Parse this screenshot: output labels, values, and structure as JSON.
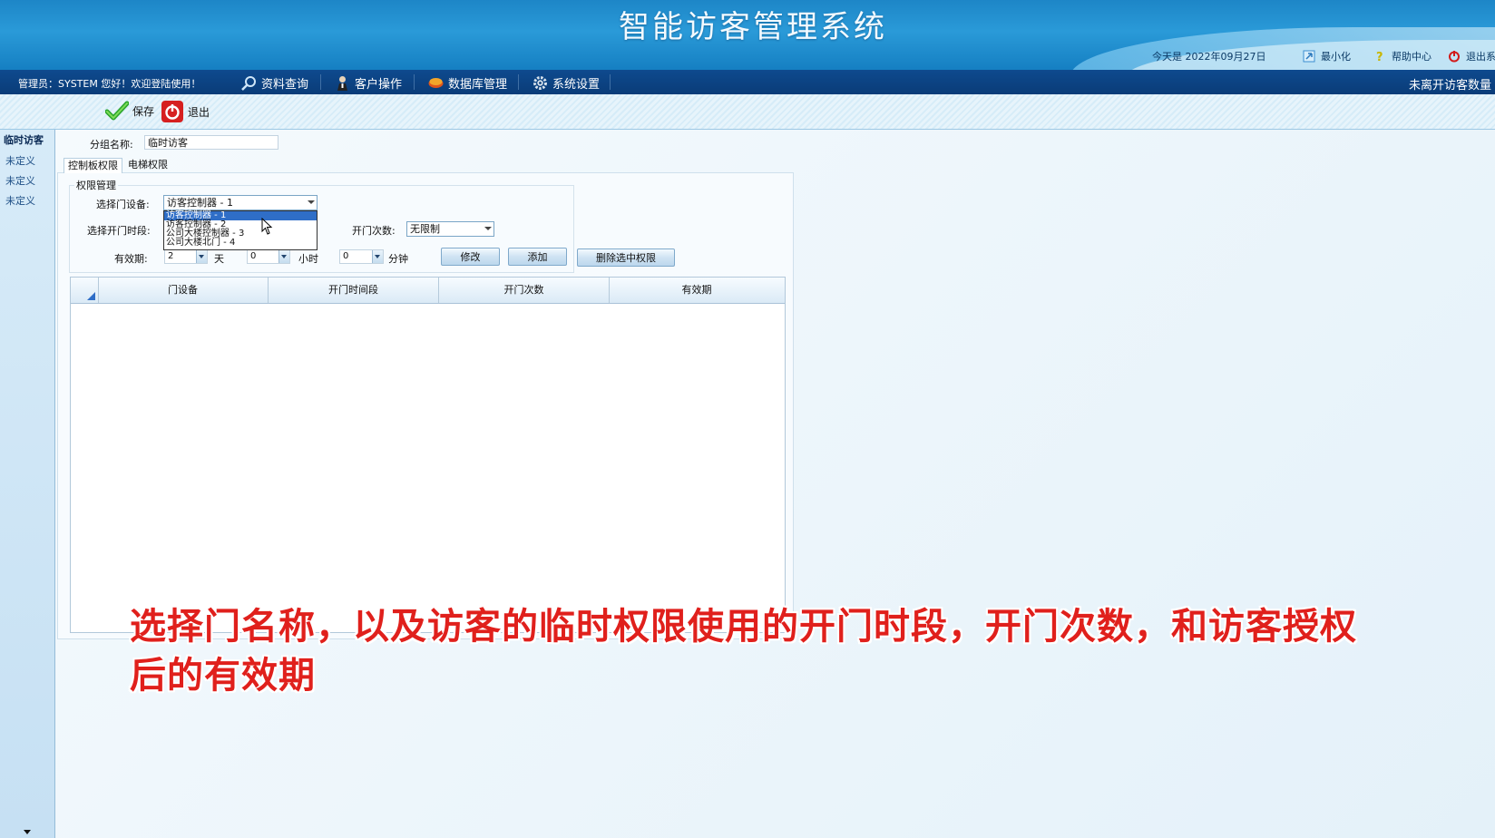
{
  "header": {
    "title": "智能访客管理系统",
    "date_text": "今天是 2022年09月27日",
    "minimize_label": "最小化",
    "help_label": "帮助中心",
    "exit_label": "退出系"
  },
  "menubar": {
    "admin_text": "管理员：SYSTEM 您好！欢迎登陆使用！",
    "items": [
      {
        "label": "资料查询",
        "icon": "search-icon"
      },
      {
        "label": "客户操作",
        "icon": "user-icon"
      },
      {
        "label": "数据库管理",
        "icon": "database-icon"
      },
      {
        "label": "系统设置",
        "icon": "gear-icon"
      }
    ],
    "right_text": "未离开访客数量"
  },
  "toolbar": {
    "save_label": "保存",
    "exit_label": "退出"
  },
  "sidebar": {
    "header": "临时访客",
    "items": [
      "未定义",
      "未定义",
      "未定义"
    ]
  },
  "form": {
    "group_name_label": "分组名称:",
    "group_name_value": "临时访客",
    "tabs": [
      "控制板权限",
      "电梯权限"
    ],
    "groupbox_title": "权限管理",
    "door_label": "选择门设备:",
    "door_selected": "访客控制器 - 1",
    "door_options": [
      "访客控制器 - 1",
      "访客控制器 - 2",
      "公司大楼控制器 - 3",
      "公司大楼北门 - 4"
    ],
    "time_label": "选择开门时段:",
    "count_label": "开门次数:",
    "count_value": "无限制",
    "validity_label": "有效期:",
    "days_value": "2",
    "days_unit": "天",
    "hours_value": "0",
    "hours_unit": "小时",
    "minutes_value": "0",
    "minutes_unit": "分钟",
    "modify_button": "修改",
    "add_button": "添加",
    "delete_button": "删除选中权限"
  },
  "table": {
    "columns": [
      "门设备",
      "开门时间段",
      "开门次数",
      "有效期"
    ],
    "rows": []
  },
  "subtitle": "选择门名称，以及访客的临时权限使用的开门时段，开门次数，和访客授权后的有效期",
  "colors": {
    "banner": "#1d86c7",
    "menubar": "#0e4a8e",
    "selection": "#2f6ec7",
    "subtitle": "#e0201c"
  }
}
